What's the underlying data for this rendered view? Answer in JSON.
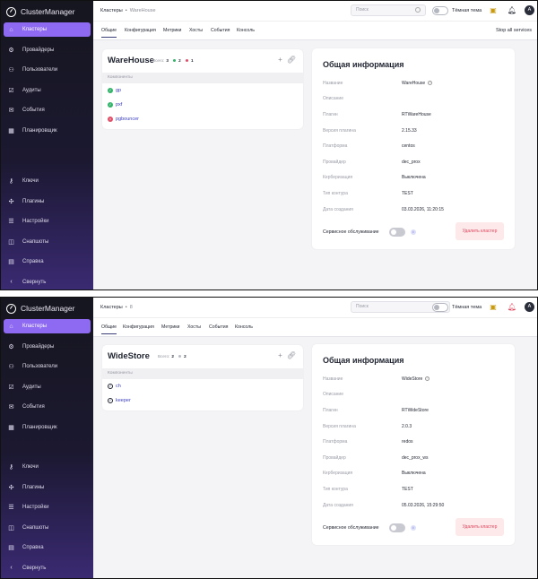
{
  "app": {
    "title": "ClusterManager"
  },
  "sidebar": {
    "items": [
      {
        "label": "Кластеры",
        "icon": "home-icon"
      },
      {
        "label": "Провайдеры",
        "icon": "gear-icon"
      },
      {
        "label": "Пользователи",
        "icon": "users-icon"
      },
      {
        "label": "Аудиты",
        "icon": "checklist-icon"
      },
      {
        "label": "События",
        "icon": "mail-icon"
      },
      {
        "label": "Планировщик",
        "icon": "scheduler-icon"
      }
    ],
    "bottom_items": [
      {
        "label": "Ключи",
        "icon": "key-icon"
      },
      {
        "label": "Плагины",
        "icon": "puzzle-icon"
      },
      {
        "label": "Настройки",
        "icon": "sliders-icon"
      },
      {
        "label": "Снапшоты",
        "icon": "database-icon"
      },
      {
        "label": "Справка",
        "icon": "book-icon"
      },
      {
        "label": "Свернуть",
        "icon": "chevron-left-icon"
      }
    ]
  },
  "topbar": {
    "search_placeholder": "Поиск",
    "dark_theme_label": "Тёмная тема",
    "avatar_letter": "A"
  },
  "tabs": [
    "Общие",
    "Конфигурация",
    "Метрики",
    "Хосты",
    "События",
    "Консоль"
  ],
  "screens": [
    {
      "breadcrumb": {
        "root": "Кластеры",
        "current": "WareHouse"
      },
      "stop_all_label": "Stop all services",
      "cluster": {
        "name": "WareHouse",
        "total_label": "Всего:",
        "total": "3",
        "ok_count": "2",
        "err_count": "1",
        "components_header": "Компоненты",
        "components": [
          {
            "name": "gp",
            "status": "ok"
          },
          {
            "name": "pxf",
            "status": "ok"
          },
          {
            "name": "pgbouncer",
            "status": "err"
          }
        ]
      },
      "info": {
        "title": "Общая информация",
        "rows": [
          {
            "k": "Название",
            "v": "WareHouse"
          },
          {
            "k": "Описание",
            "v": ""
          },
          {
            "k": "Плагин",
            "v": "RTWareHouse"
          },
          {
            "k": "Версия плагина",
            "v": "2.15.33"
          },
          {
            "k": "Платформа",
            "v": "centos"
          },
          {
            "k": "Провайдер",
            "v": "dec_prox"
          },
          {
            "k": "Керберизация",
            "v": "Выключена"
          },
          {
            "k": "Тип контура",
            "v": "TEST"
          },
          {
            "k": "Дата создания",
            "v": "03.03.2026, 11:20:15"
          }
        ],
        "service_label": "Сервисное обслуживание",
        "delete_label": "Удалить кластер"
      }
    },
    {
      "breadcrumb": {
        "root": "Кластеры",
        "current": "8"
      },
      "stop_all_label": "",
      "cluster": {
        "name": "WideStore",
        "total_label": "Всего:",
        "total": "2",
        "ok_count": "",
        "err_count": "",
        "neutral_count": "2",
        "components_header": "Компоненты",
        "components": [
          {
            "name": "ch",
            "status": "outline"
          },
          {
            "name": "keeper",
            "status": "outline"
          }
        ]
      },
      "info": {
        "title": "Общая информация",
        "rows": [
          {
            "k": "Название",
            "v": "WideStore"
          },
          {
            "k": "Описание",
            "v": ""
          },
          {
            "k": "Плагин",
            "v": "RTWideStore"
          },
          {
            "k": "Версия плагина",
            "v": "2.0.3"
          },
          {
            "k": "Платформа",
            "v": "redos"
          },
          {
            "k": "Провайдер",
            "v": "dec_prox_ws"
          },
          {
            "k": "Керберизация",
            "v": "Выключена"
          },
          {
            "k": "Тип контура",
            "v": "TEST"
          },
          {
            "k": "Дата создания",
            "v": "05.03.2026, 15:29:50"
          }
        ],
        "service_label": "Сервисное обслуживание",
        "delete_label": "Удалить кластер"
      }
    }
  ],
  "colors": {
    "accent": "#8e6af2",
    "link": "#3b3fc4",
    "ok": "#34b36a",
    "error": "#e0506a"
  }
}
